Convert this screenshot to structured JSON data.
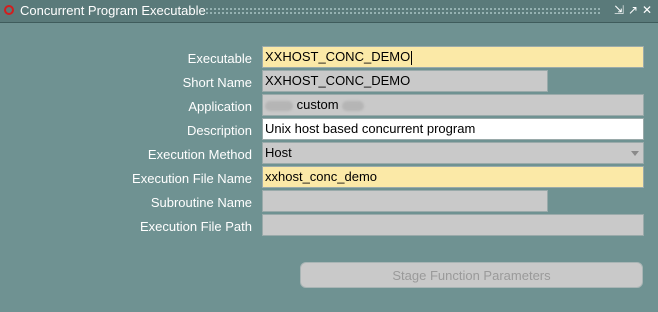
{
  "window": {
    "title": "Concurrent Program Executable"
  },
  "form": {
    "executable": {
      "label": "Executable",
      "value": "XXHOST_CONC_DEMO"
    },
    "short_name": {
      "label": "Short Name",
      "value": "XXHOST_CONC_DEMO"
    },
    "application": {
      "label": "Application",
      "value": "custom"
    },
    "description": {
      "label": "Description",
      "value": "Unix host based concurrent program"
    },
    "execution_method": {
      "label": "Execution Method",
      "value": "Host"
    },
    "execution_file_name": {
      "label": "Execution File Name",
      "value": "xxhost_conc_demo"
    },
    "subroutine_name": {
      "label": "Subroutine Name",
      "value": ""
    },
    "execution_file_path": {
      "label": "Execution File Path",
      "value": ""
    }
  },
  "buttons": {
    "stage_function_parameters": "Stage Function Parameters"
  },
  "colors": {
    "background": "#6f9292",
    "required_field": "#fbe9a7",
    "readonly_field": "#c9c9c9",
    "oracle_logo": "#d21e1e"
  }
}
